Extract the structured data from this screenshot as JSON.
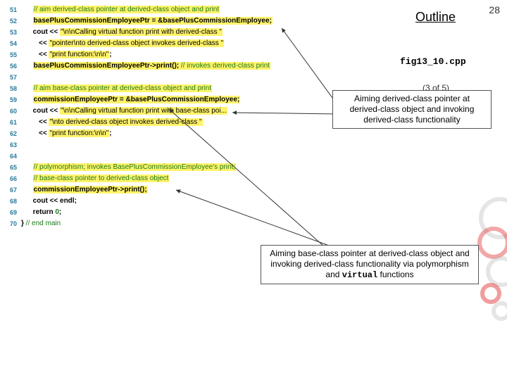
{
  "page_number": "28",
  "outline_label": "Outline",
  "filename": "fig13_10.cpp",
  "part_of": "(3 of 5)",
  "callouts": {
    "top": "Aiming derived-class pointer at derived-class object and invoking derived-class functionality",
    "bottom_pre": "Aiming base-class pointer at derived-class object and invoking derived-class functionality via polymorphism and ",
    "bottom_code": "virtual",
    "bottom_post": " functions"
  },
  "code": {
    "l51c": "// aim derived-class pointer at derived-class object and print",
    "l52": "basePlusCommissionEmployeePtr = &basePlusCommissionEmployee;",
    "l53a": "cout << ",
    "l53s": "\"\\n\\nCalling virtual function print with derived-class \"",
    "l54s": "\"pointer\\nto derived-class object invokes derived-class \"",
    "l55s": "\"print function:\\n\\n\"",
    "l56a": "basePlusCommissionEmployeePtr->print();",
    "l56c": " // invokes derived-class print",
    "l58c": "// aim base-class pointer at derived-class object and print",
    "l59": "commissionEmployeePtr = &basePlusCommissionEmployee;",
    "l60a": "cout << ",
    "l60s": "\"\\n\\nCalling virtual function print with base-class poi...",
    "l61s": "\"\\nto derived-class object invokes derived-class \"",
    "l62s": "\"print function:\\n\\n\"",
    "l65c": "// polymorphism; invokes BasePlusCommissionEmployee's print;",
    "l66c": "// base-class pointer to derived-class object",
    "l67": "commissionEmployeePtr->print();",
    "l68a": "cout << endl;",
    "l69a": "return",
    "l69b": "0",
    "l70a": "}",
    "l70c": " // end main",
    "ind": "      ",
    "ind2": "         << ",
    "semi": ";"
  },
  "lines": [
    "51",
    "52",
    "53",
    "54",
    "55",
    "56",
    "57",
    "58",
    "59",
    "60",
    "61",
    "62",
    "63",
    "64",
    "65",
    "66",
    "67",
    "68",
    "69",
    "70"
  ]
}
